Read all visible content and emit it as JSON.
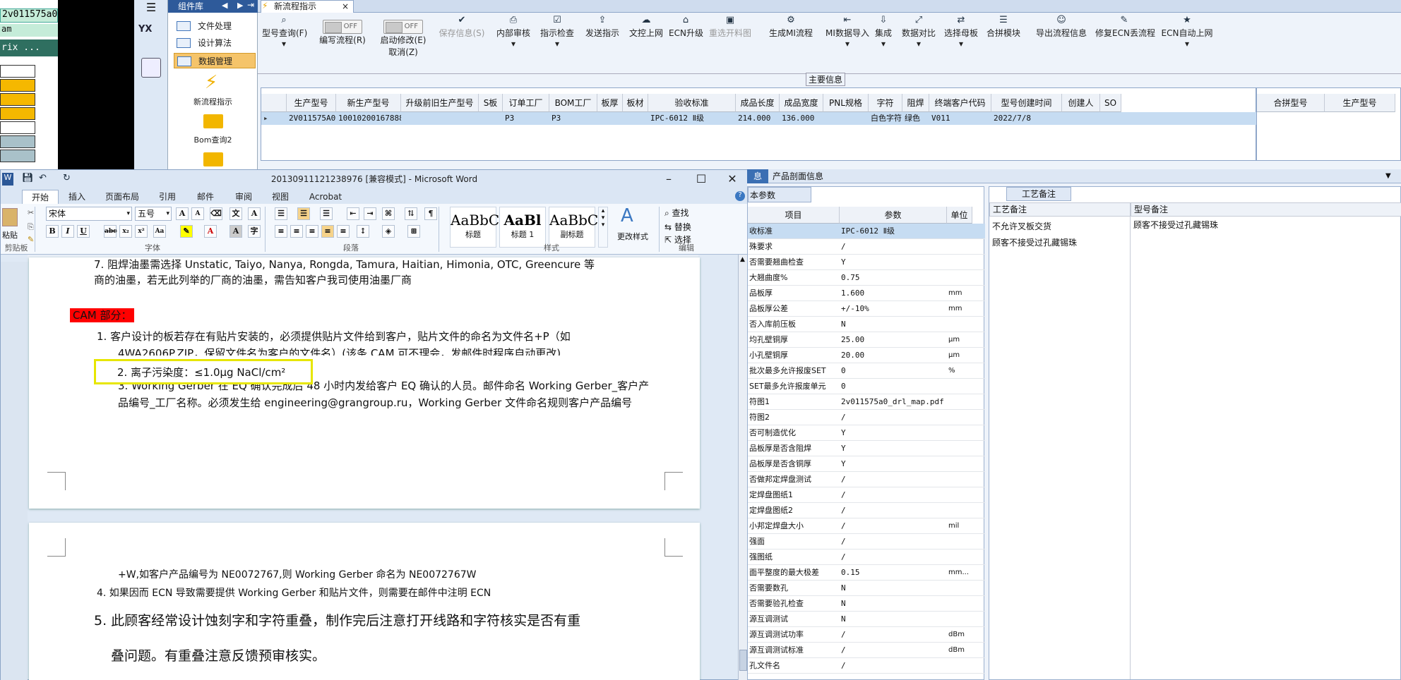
{
  "left_app": {
    "title": "2v011575a0",
    "sub": "am",
    "dark_text": "rix ..."
  },
  "palette": {
    "header": "组件库",
    "items": [
      "文件处理",
      "设计算法",
      "数据管理"
    ],
    "big_items": [
      "新流程指示",
      "Bom查询2"
    ],
    "nav_label": "YX"
  },
  "app": {
    "tab": "新流程指示",
    "toolbar": [
      {
        "label": "型号查询(F)",
        "icon": "search-icon"
      },
      {
        "label": "编写流程(R)",
        "icon": "toggle-off"
      },
      {
        "label": "启动修改(E)",
        "label2": "取消(Z)",
        "icon": "toggle-off"
      },
      {
        "label": "保存信息(S)",
        "icon": "save-icon"
      },
      {
        "label": "内部审核",
        "icon": "print-icon"
      },
      {
        "label": "指示检查",
        "icon": "check-icon"
      },
      {
        "label": "发送指示",
        "icon": "upload-icon"
      },
      {
        "label": "文控上网",
        "icon": "cloud-icon"
      },
      {
        "label": "ECN升级",
        "icon": "ecn-icon"
      },
      {
        "label": "重选开料图",
        "icon": "image-icon"
      },
      {
        "label": "生成MI流程",
        "icon": "gear-icon"
      },
      {
        "label": "MI数据导入",
        "icon": "import-icon"
      },
      {
        "label": "集成",
        "icon": "download-icon"
      },
      {
        "label": "数据对比",
        "icon": "compare-icon"
      },
      {
        "label": "选择母板",
        "icon": "shuffle-icon"
      },
      {
        "label": "合拼模块",
        "icon": "list-icon"
      },
      {
        "label": "导出流程信息",
        "icon": "smile-icon"
      },
      {
        "label": "修复ECN丢流程",
        "icon": "wrench-icon"
      },
      {
        "label": "ECN自动上网",
        "icon": "star-icon"
      }
    ],
    "toggle_text": "OFF",
    "main_info": "主要信息",
    "grid": {
      "headers": [
        "生产型号",
        "新生产型号",
        "升级前旧生产型号",
        "S板",
        "订单工厂",
        "BOM工厂",
        "板厚",
        "板材",
        "验收标准",
        "成品长度",
        "成品宽度",
        "PNL规格",
        "字符",
        "阻焊",
        "终端客户代码",
        "型号创建时间",
        "创建人",
        "SO"
      ],
      "row": [
        "2V011575A0",
        "10010200167888",
        "",
        "",
        "P3",
        "P3",
        "",
        "",
        "IPC-6012 Ⅱ级",
        "214.000",
        "136.000",
        "",
        "白色字符",
        "绿色",
        "V011",
        "2022/7/8",
        "",
        ""
      ]
    },
    "right_grid_headers": [
      "合拼型号",
      "生产型号"
    ]
  },
  "word": {
    "title": "20130911121238976 [兼容模式] - Microsoft Word",
    "tabs": [
      "开始",
      "插入",
      "页面布局",
      "引用",
      "邮件",
      "审阅",
      "视图",
      "Acrobat"
    ],
    "font": "宋体",
    "size": "五号",
    "groups": [
      "剪贴板",
      "字体",
      "段落",
      "样式",
      "编辑"
    ],
    "paste": "粘贴",
    "styles": [
      {
        "sample": "AaBbC",
        "name": "标题"
      },
      {
        "sample": "AaBl",
        "name": "标题 1"
      },
      {
        "sample": "AaBbC",
        "name": "副标题"
      }
    ],
    "more_styles": "更改样式",
    "edit": [
      "查找",
      "替换",
      "选择"
    ],
    "doc": {
      "line1": "7.   阻焊油墨需选择 Unstatic, Taiyo, Nanya, Rongda, Tamura, Haitian, Himonia, OTC, Greencure 等",
      "line2": "商的油墨，若无此列举的厂商的油墨，需告知客户我司使用油墨厂商",
      "cam": "CAM 部分：",
      "i1a": "1.    客户设计的板若存在有贴片安装的，必须提供贴片文件给到客户，贴片文件的命名为文件名+P（如",
      "i1b": "4WA2606P.ZIP，保留文件名为客户的文件名）(该条 CAM 可不理会，发邮件时程序自动更改)",
      "i2": "2.   离子污染度：≤1.0μg NaCl/cm²",
      "i3a": "3.    Working Gerber 在 EQ 确认完成后 48 小时内发给客户 EQ 确认的人员。邮件命名 Working Gerber_客户产",
      "i3b": "品编号_工厂名称。必须发生给 engineering@grangroup.ru，Working Gerber 文件命名规则客户产品编号",
      "p2a": "+W,如客户产品编号为 NE0072767,则 Working Gerber 命名为 NE0072767W",
      "p2b": "4.   如果因而 ECN 导致需要提供 Working Gerber 和贴片文件，则需要在邮件中注明 ECN",
      "p2c": "5. 此顾客经常设计蚀刻字和字符重叠，制作完后注意打开线路和字符核实是否有重",
      "p2d": "叠问题。有重叠注意反馈预审核实。"
    }
  },
  "right": {
    "tabs": [
      "息",
      "产品剖面信息"
    ],
    "sub_tab": "本参数",
    "headers": [
      "项目",
      "参数",
      "单位"
    ],
    "rows": [
      [
        "收标准",
        "IPC-6012 Ⅱ级",
        ""
      ],
      [
        "殊要求",
        "/",
        ""
      ],
      [
        "否需要翘曲检查",
        "Y",
        ""
      ],
      [
        "大翘曲度%",
        "0.75",
        ""
      ],
      [
        "品板厚",
        "1.600",
        "mm"
      ],
      [
        "品板厚公差",
        "+/-10%",
        "mm"
      ],
      [
        "否入库前压板",
        "N",
        ""
      ],
      [
        "均孔壁铜厚",
        "25.00",
        "μm"
      ],
      [
        "小孔壁铜厚",
        "20.00",
        "μm"
      ],
      [
        "批次最多允许报废SET",
        "0",
        "%"
      ],
      [
        "SET最多允许报废单元",
        "0",
        ""
      ],
      [
        "符图1",
        "2v011575a0_drl_map.pdf",
        ""
      ],
      [
        "符图2",
        "/",
        ""
      ],
      [
        "否可制造优化",
        "Y",
        ""
      ],
      [
        "品板厚是否含阻焊",
        "Y",
        ""
      ],
      [
        "品板厚是否含铜厚",
        "Y",
        ""
      ],
      [
        "否做邦定焊盘测试",
        "/",
        ""
      ],
      [
        "定焊盘图纸1",
        "/",
        ""
      ],
      [
        "定焊盘图纸2",
        "/",
        ""
      ],
      [
        "小邦定焊盘大小",
        "/",
        "mil"
      ],
      [
        "强面",
        "/",
        ""
      ],
      [
        "强图纸",
        "/",
        ""
      ],
      [
        "面平整度的最大极差",
        "0.15",
        "mm..."
      ],
      [
        "否需要数孔",
        "N",
        ""
      ],
      [
        "否需要验孔检查",
        "N",
        ""
      ],
      [
        "源互调测试",
        "N",
        ""
      ],
      [
        "源互调测试功率",
        "/",
        "dBm"
      ],
      [
        "源互调测试标准",
        "/",
        "dBm"
      ],
      [
        "孔文件名",
        "/",
        ""
      ]
    ],
    "craft_tab": "工艺备注",
    "craft_headers": [
      "工艺备注",
      "型号备注"
    ],
    "craft_notes": [
      "不允许叉板交货",
      "顾客不接受过孔藏锡珠"
    ],
    "model_notes": [
      "顾客不接受过孔藏锡珠"
    ]
  }
}
